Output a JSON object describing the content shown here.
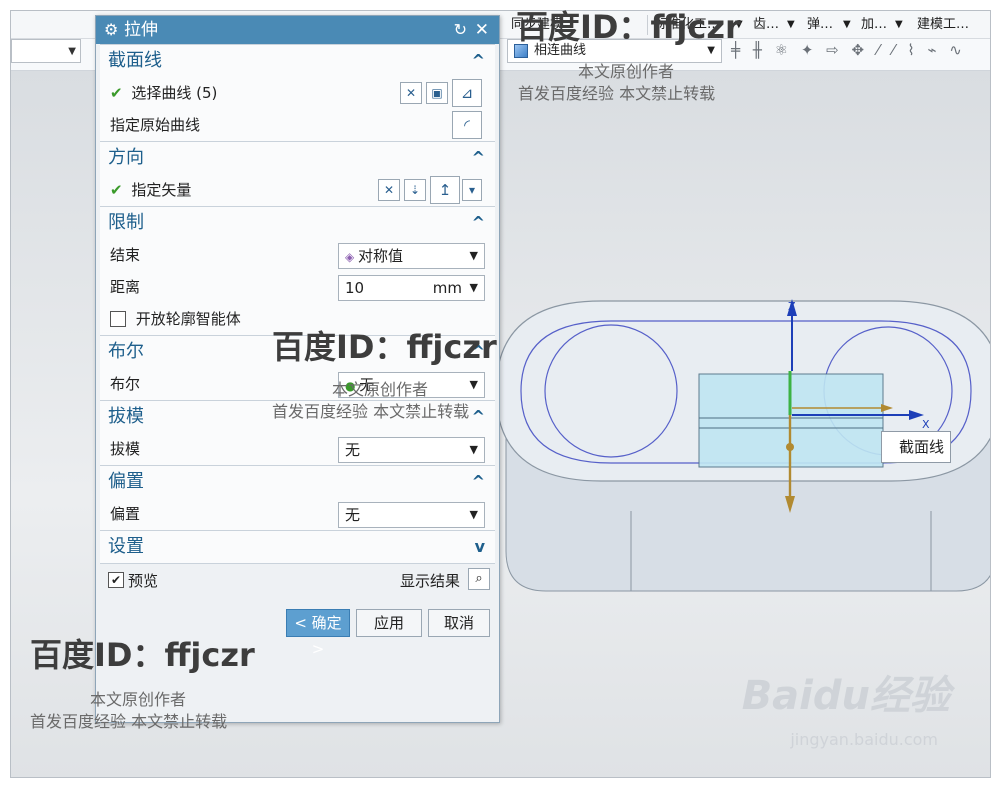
{
  "toolbar": {
    "menus": [
      "同步建模",
      "标准化工…",
      "齿…",
      "弹…",
      "加…",
      "建模工…"
    ],
    "filter": "相连曲线"
  },
  "dialog": {
    "title": "拉伸",
    "sections": {
      "section_curve": {
        "title": "截面线",
        "select_curve": "选择曲线 (5)",
        "original_curve": "指定原始曲线"
      },
      "direction": {
        "title": "方向",
        "vector": "指定矢量"
      },
      "limits": {
        "title": "限制",
        "end_label": "结束",
        "end_value": "对称值",
        "distance_label": "距离",
        "distance_value": "10",
        "distance_unit": "mm",
        "open_profile": "开放轮廓智能体"
      },
      "boolean": {
        "title": "布尔",
        "label": "布尔",
        "value": "无"
      },
      "draft": {
        "title": "拔模",
        "label": "拔模",
        "value": "无"
      },
      "offset": {
        "title": "偏置",
        "label": "偏置",
        "value": "无"
      },
      "settings": {
        "title": "设置"
      }
    },
    "footer": {
      "preview": "预览",
      "show_result": "显示结果",
      "ok": "< 确定 >",
      "apply": "应用",
      "cancel": "取消"
    }
  },
  "viewport": {
    "axis_z": "Z",
    "axis_x": "X",
    "tooltip": "截面线"
  },
  "watermark": {
    "id_text": "百度ID：ffjczr",
    "line1": "本文原创作者",
    "line2": "首发百度经验   本文禁止转载",
    "logo": "Baidu经验",
    "url": "jingyan.baidu.com"
  },
  "colors": {
    "title_bar": "#4a8ab5",
    "section_heading": "#1e5f8c",
    "check": "#3a9a2a",
    "ok_button": "#5d9fd0"
  }
}
